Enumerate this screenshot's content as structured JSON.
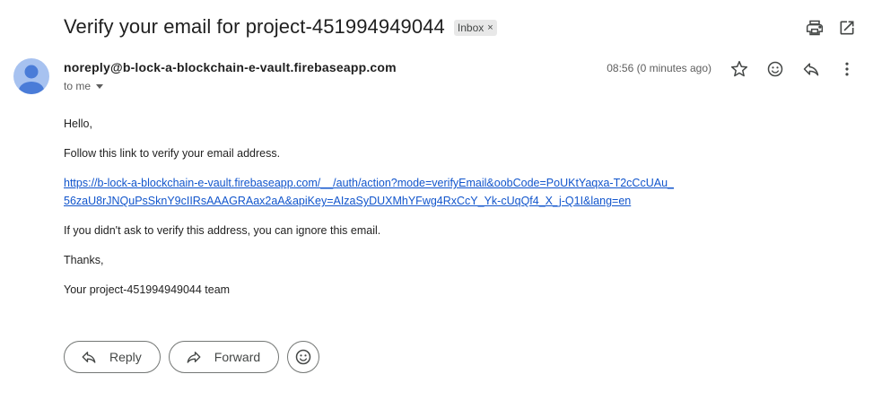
{
  "email": {
    "subject": "Verify your email for project-451994949044",
    "label": "Inbox",
    "label_close": "×",
    "sender": "noreply@b-lock-a-blockchain-e-vault.firebaseapp.com",
    "recipient": "to me",
    "timestamp": "08:56 (0 minutes ago)",
    "body": {
      "greeting": "Hello,",
      "instruction": "Follow this link to verify your email address.",
      "link_line1": "https://b-lock-a-blockchain-e-vault.firebaseapp.com/__/auth/action?mode=verifyEmail&oobCode=PoUKtYaqxa-T2cCcUAu_",
      "link_line2": "56zaU8rJNQuPsSknY9cIIRsAAAGRAax2aA&apiKey=AIzaSyDUXMhYFwg4RxCcY_Yk-cUqQf4_X_j-Q1I&lang=en",
      "ignore_note": "If you didn't ask to verify this address, you can ignore this email.",
      "thanks": "Thanks,",
      "signature": "Your project-451994949044 team"
    }
  },
  "actions": {
    "reply_label": "Reply",
    "forward_label": "Forward"
  },
  "icons": {
    "print": "print-icon",
    "open_new": "open-in-new-window-icon",
    "star": "star-icon",
    "emoji": "emoji-icon",
    "reply": "reply-icon",
    "more": "more-vert-icon",
    "forward": "forward-icon",
    "avatar": "person-icon"
  },
  "colors": {
    "link": "#1155cc",
    "avatar_bg": "#a7c2f0",
    "avatar_fg": "#4a7cd8"
  }
}
